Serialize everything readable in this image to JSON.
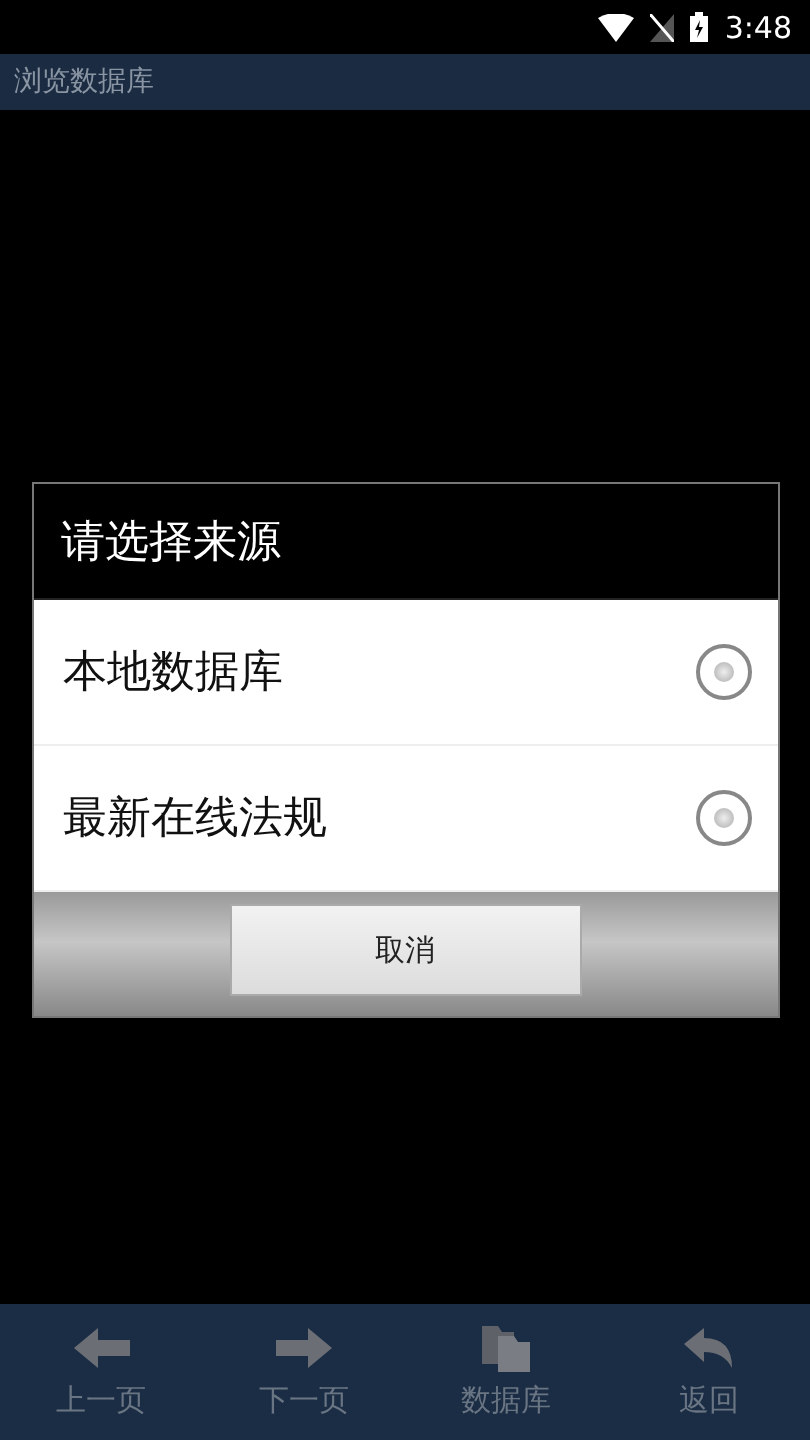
{
  "status_bar": {
    "time": "3:48"
  },
  "window": {
    "title": "浏览数据库"
  },
  "dialog": {
    "title": "请选择来源",
    "options": [
      {
        "label": "本地数据库",
        "selected": false
      },
      {
        "label": "最新在线法规",
        "selected": false
      }
    ],
    "cancel_button": "取消"
  },
  "bottom_nav": [
    {
      "label": "上一页",
      "kind": "back"
    },
    {
      "label": "下一页",
      "kind": "forward"
    },
    {
      "label": "数据库",
      "kind": "database"
    },
    {
      "label": "返回",
      "kind": "return"
    }
  ]
}
